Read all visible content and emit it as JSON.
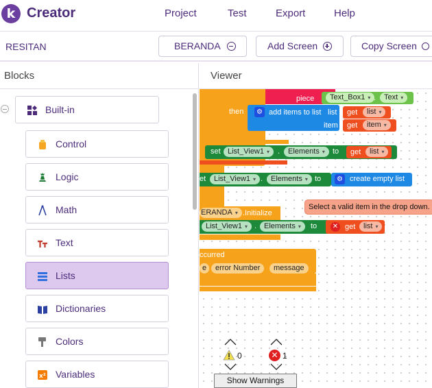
{
  "app": {
    "brand": "Creator",
    "logo_letter": "k"
  },
  "menu": [
    {
      "label": "Project"
    },
    {
      "label": "Test"
    },
    {
      "label": "Export"
    },
    {
      "label": "Help"
    }
  ],
  "project": {
    "name": "RESITAN",
    "screen_button": "BERANDA",
    "add_screen": "Add Screen",
    "copy_screen": "Copy Screen"
  },
  "blocks_panel": {
    "title": "Blocks",
    "builtin": "Built-in",
    "categories": [
      {
        "label": "Control",
        "icon": "control-icon",
        "color": "#f5a623"
      },
      {
        "label": "Logic",
        "icon": "logic-icon",
        "color": "#1a7a2f"
      },
      {
        "label": "Math",
        "icon": "math-icon",
        "color": "#2b3fa0"
      },
      {
        "label": "Text",
        "icon": "text-icon",
        "color": "#c0392b"
      },
      {
        "label": "Lists",
        "icon": "lists-icon",
        "color": "#2f6fdf",
        "selected": true
      },
      {
        "label": "Dictionaries",
        "icon": "dictionaries-icon",
        "color": "#2b3fa0"
      },
      {
        "label": "Colors",
        "icon": "colors-icon",
        "color": "#777777"
      },
      {
        "label": "Variables",
        "icon": "variables-icon",
        "color": "#f57c00"
      }
    ]
  },
  "viewer": {
    "title": "Viewer",
    "blocks": {
      "piece": "piece",
      "text_box": "Text_Box1",
      "text_prop": "Text",
      "then": "then",
      "add_items": "add items to list",
      "list_kw": "list",
      "item_kw": "item",
      "get": "get",
      "get_list_val": "list",
      "get_item_val": "item",
      "set": "set",
      "list_view": "List_View1",
      "elements": "Elements",
      "to": "to",
      "create_empty": "create empty list",
      "set_cut": "et",
      "beranda_cut": "ERANDA",
      "initialize": ".Initialize",
      "occurred": "ccurred",
      "e_cut": "e",
      "error_number": "error Number",
      "message": "message",
      "dot": "."
    },
    "warning_text": "Select a valid item in the drop down.",
    "warnings_count": "0",
    "errors_count": "1",
    "show_warnings": "Show Warnings"
  },
  "colors": {
    "accent": "#4b2b7a",
    "control_block": "#f5a623",
    "list_block": "#ef4e1e",
    "component_block": "#1c8a3a",
    "text_block": "#6cc24a",
    "procedure_block": "#1e88e5",
    "event_block": "#f7a21b"
  }
}
